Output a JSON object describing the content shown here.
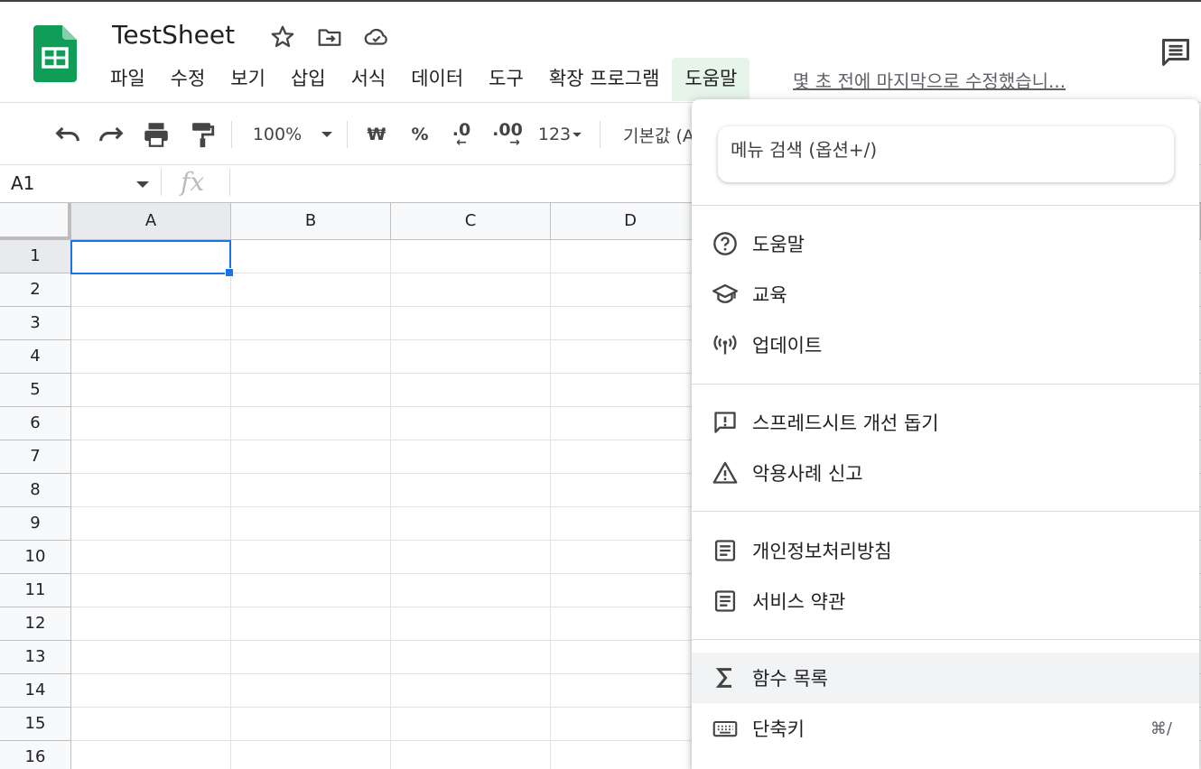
{
  "app": {
    "doc_title": "TestSheet",
    "last_edit": "몇 초 전에 마지막으로 수정했습니...",
    "brand_color": "#0f9d58"
  },
  "menubar": {
    "items": [
      "파일",
      "수정",
      "보기",
      "삽입",
      "서식",
      "데이터",
      "도구",
      "확장 프로그램",
      "도움말"
    ],
    "active": "도움말"
  },
  "toolbar": {
    "zoom": "100%",
    "currency": "₩",
    "percent": "%",
    "decrease_decimal": ".0",
    "increase_decimal": ".00",
    "number_format": "123",
    "font": "기본값 (A"
  },
  "formula_bar": {
    "name_box": "A1",
    "fx_label": "fx",
    "formula": ""
  },
  "sheet": {
    "columns": [
      "A",
      "B",
      "C",
      "D"
    ],
    "rows": [
      "1",
      "2",
      "3",
      "4",
      "5",
      "6",
      "7",
      "8",
      "9",
      "10",
      "11",
      "12",
      "13",
      "14",
      "15",
      "16"
    ],
    "selected_cell": "A1"
  },
  "help_menu": {
    "search_placeholder": "메뉴 검색 (옵션+/)",
    "items": [
      {
        "label": "도움말",
        "icon": "help-circle-icon"
      },
      {
        "label": "교육",
        "icon": "graduation-cap-icon"
      },
      {
        "label": "업데이트",
        "icon": "broadcast-icon"
      },
      {
        "label": "스프레드시트 개선 돕기",
        "icon": "feedback-icon"
      },
      {
        "label": "악용사례 신고",
        "icon": "warning-icon"
      },
      {
        "label": "개인정보처리방침",
        "icon": "document-icon"
      },
      {
        "label": "서비스 약관",
        "icon": "document-icon"
      },
      {
        "label": "함수 목록",
        "icon": "sigma-icon"
      },
      {
        "label": "단축키",
        "icon": "keyboard-icon",
        "shortcut": "⌘/"
      }
    ]
  }
}
